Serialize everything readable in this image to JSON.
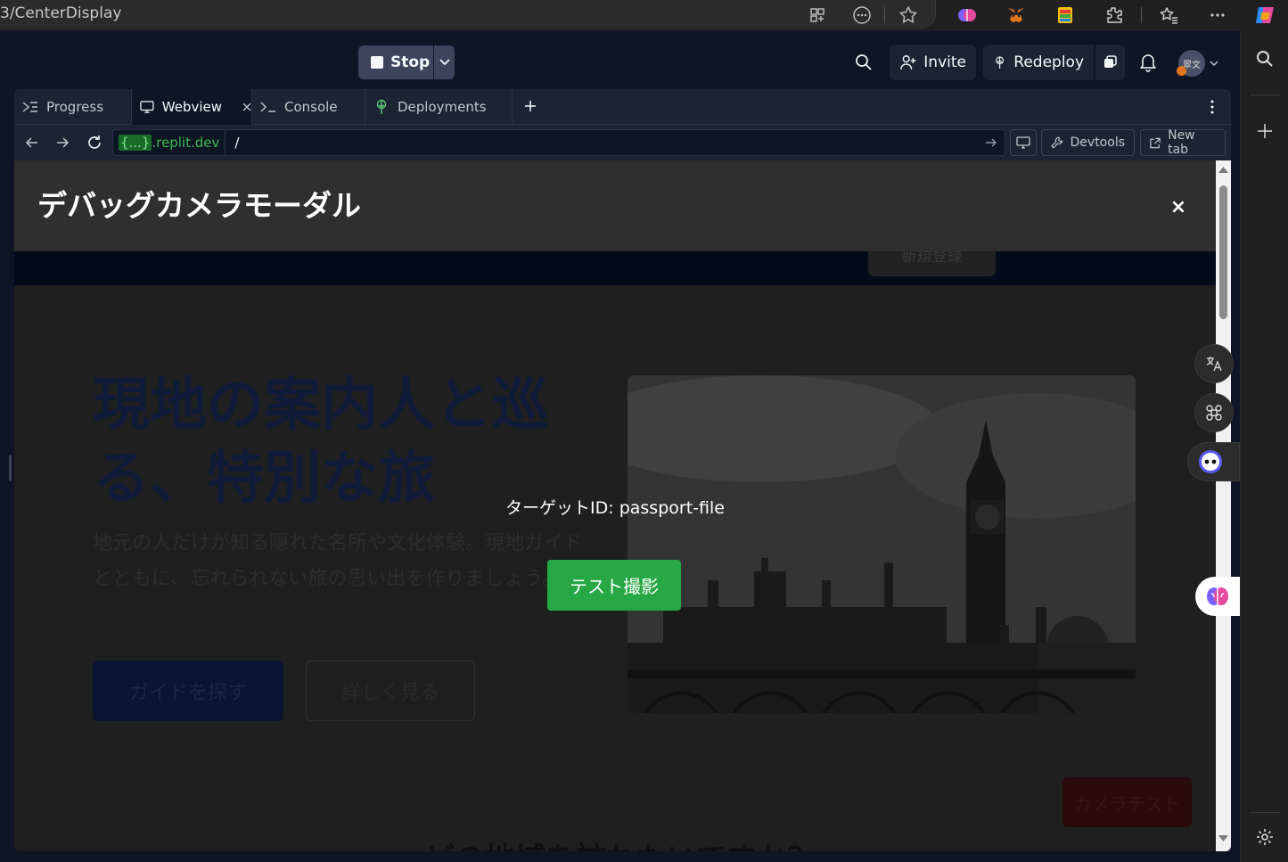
{
  "browser": {
    "address": "3/CenterDisplay",
    "icons": [
      "apps-icon",
      "more-icon",
      "favorite-star-icon",
      "brain-extension-icon",
      "metamask-icon",
      "colorful-extension-icon",
      "extensions-puzzle-icon",
      "favorites-icon",
      "menu-dots-icon",
      "copilot-icon"
    ]
  },
  "edge_sidebar": {
    "icons": [
      "search-icon",
      "add-icon",
      "settings-icon"
    ]
  },
  "toolbar": {
    "stop_label": "Stop",
    "invite_label": "Invite",
    "redeploy_label": "Redeploy",
    "avatar_text": "翠文"
  },
  "tabs": [
    {
      "label": "Progress",
      "icon": "progress-icon"
    },
    {
      "label": "Webview",
      "icon": "monitor-icon",
      "active": true
    },
    {
      "label": "Console",
      "icon": "terminal-icon"
    },
    {
      "label": "Deployments",
      "icon": "deploy-icon"
    }
  ],
  "url": {
    "curly": "{...}",
    "domain_suffix": ".replit.dev",
    "path": "/",
    "devtools_label": "Devtools",
    "newtab_label": "New tab"
  },
  "site": {
    "signup_label": "新規登録",
    "hero_title": "現地の案内人と巡る、特別な旅",
    "hero_desc": "地元の人だけが知る隠れた名所や文化体験。現地ガイドとともに、忘れられない旅の思い出を作りましょう。",
    "find_guide_label": "ガイドを探す",
    "more_label": "詳しく見る",
    "camera_test_label": "カメラテスト",
    "bottom_heading": "どの地域を訪れたいですか？"
  },
  "modal": {
    "title": "デバッグカメラモーダル",
    "close_label": "×",
    "target_label": "ターゲットID: passport-file",
    "test_capture_label": "テスト撮影"
  },
  "colors": {
    "accent_green": "#28a745",
    "replit_bg": "#0e1525",
    "panel_bg": "#1c2333"
  }
}
